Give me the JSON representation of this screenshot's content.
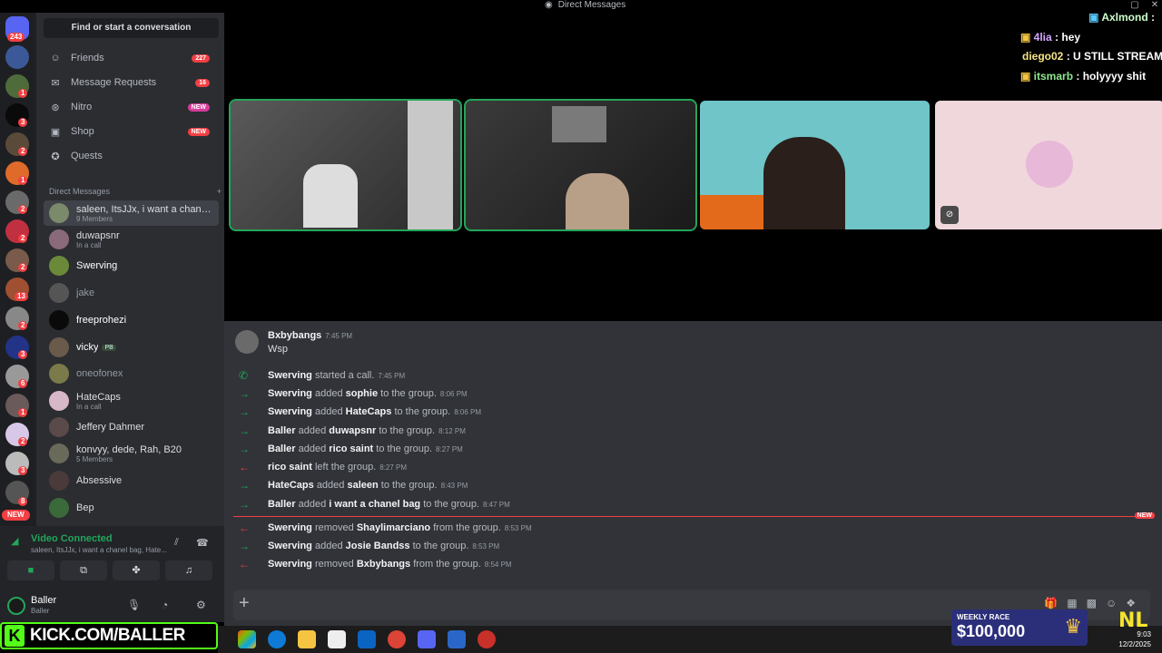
{
  "window": {
    "title": "Direct Messages"
  },
  "rail": {
    "home_badge": "243",
    "new_label": "NEW",
    "badges": [
      "1",
      "3",
      "2",
      "1",
      "2",
      "2",
      "2",
      "13",
      "2",
      "3",
      "6",
      "1",
      "2",
      "3",
      "8"
    ]
  },
  "sidebar": {
    "search_label": "Find or start a conversation",
    "nav": [
      {
        "label": "Friends",
        "pill": "227"
      },
      {
        "label": "Message Requests",
        "pill": "16"
      },
      {
        "label": "Nitro",
        "pill": "NEW"
      },
      {
        "label": "Shop",
        "pill": "NEW"
      },
      {
        "label": "Quests",
        "pill": ""
      }
    ],
    "dm_header": "Direct Messages",
    "dms": [
      {
        "name": "saleen, ItsJJx, i want a chanel...",
        "sub": "9 Members"
      },
      {
        "name": "duwapsnr",
        "sub": "In a call"
      },
      {
        "name": "Swerving",
        "sub": ""
      },
      {
        "name": "jake",
        "sub": ""
      },
      {
        "name": "freeprohezi",
        "sub": ""
      },
      {
        "name": "vicky",
        "sub": "",
        "tag": "PB"
      },
      {
        "name": "oneofonex",
        "sub": ""
      },
      {
        "name": "HateCaps",
        "sub": "In a call"
      },
      {
        "name": "Jeffery Dahmer",
        "sub": ""
      },
      {
        "name": "konvyy, dede, Rah, B20",
        "sub": "5 Members"
      },
      {
        "name": "Absessive",
        "sub": ""
      },
      {
        "name": "Bep",
        "sub": ""
      }
    ]
  },
  "voice": {
    "status": "Video Connected",
    "channel": "saleen, ItsJJx, i want a chanel bag, Hate..."
  },
  "user": {
    "name": "Baller",
    "status": "Baller"
  },
  "kick": {
    "banner": "KICK.COM/BALLER",
    "k": "K"
  },
  "overlay_chat": [
    {
      "user": "Axlmond",
      "text": ""
    },
    {
      "user": "4lia",
      "text": "hey"
    },
    {
      "user": "diego02",
      "text": "U STILL STREAM"
    },
    {
      "user": "itsmarb",
      "text": "holyyyy shit"
    }
  ],
  "chat": {
    "first_message": {
      "author": "Bxbybangs",
      "time": "7:45 PM",
      "text": "Wsp"
    },
    "events": [
      {
        "dir": "call",
        "actor": "Swerving",
        "verb": "started a call.",
        "target": "",
        "tail": "",
        "time": "7:45 PM"
      },
      {
        "dir": "in",
        "actor": "Swerving",
        "verb": "added",
        "target": "sophie",
        "tail": "to the group.",
        "time": "8:06 PM"
      },
      {
        "dir": "in",
        "actor": "Swerving",
        "verb": "added",
        "target": "HateCaps",
        "tail": "to the group.",
        "time": "8:06 PM"
      },
      {
        "dir": "in",
        "actor": "Baller",
        "verb": "added",
        "target": "duwapsnr",
        "tail": "to the group.",
        "time": "8:12 PM"
      },
      {
        "dir": "in",
        "actor": "Baller",
        "verb": "added",
        "target": "rico saint",
        "tail": "to the group.",
        "time": "8:27 PM"
      },
      {
        "dir": "out",
        "actor": "rico saint",
        "verb": "left the group.",
        "target": "",
        "tail": "",
        "time": "8:27 PM"
      },
      {
        "dir": "in",
        "actor": "HateCaps",
        "verb": "added",
        "target": "saleen",
        "tail": "to the group.",
        "time": "8:43 PM"
      },
      {
        "dir": "in",
        "actor": "Baller",
        "verb": "added",
        "target": "i want a chanel bag",
        "tail": "to the group.",
        "time": "8:47 PM"
      },
      {
        "dir": "out",
        "actor": "Swerving",
        "verb": "removed",
        "target": "Shaylimarciano",
        "tail": "from the group.",
        "time": "8:53 PM"
      },
      {
        "dir": "in",
        "actor": "Swerving",
        "verb": "added",
        "target": "Josie Bandss",
        "tail": "to the group.",
        "time": "8:53 PM"
      },
      {
        "dir": "out",
        "actor": "Swerving",
        "verb": "removed",
        "target": "Bxbybangs",
        "tail": "from the group.",
        "time": "8:54 PM"
      }
    ],
    "new_tag": "NEW"
  },
  "race": {
    "line1": "WEEKLY RACE",
    "line2": "$100,000"
  },
  "nl_logo": "NL",
  "tray": {
    "time": "9:03",
    "date": "12/2/2025"
  }
}
